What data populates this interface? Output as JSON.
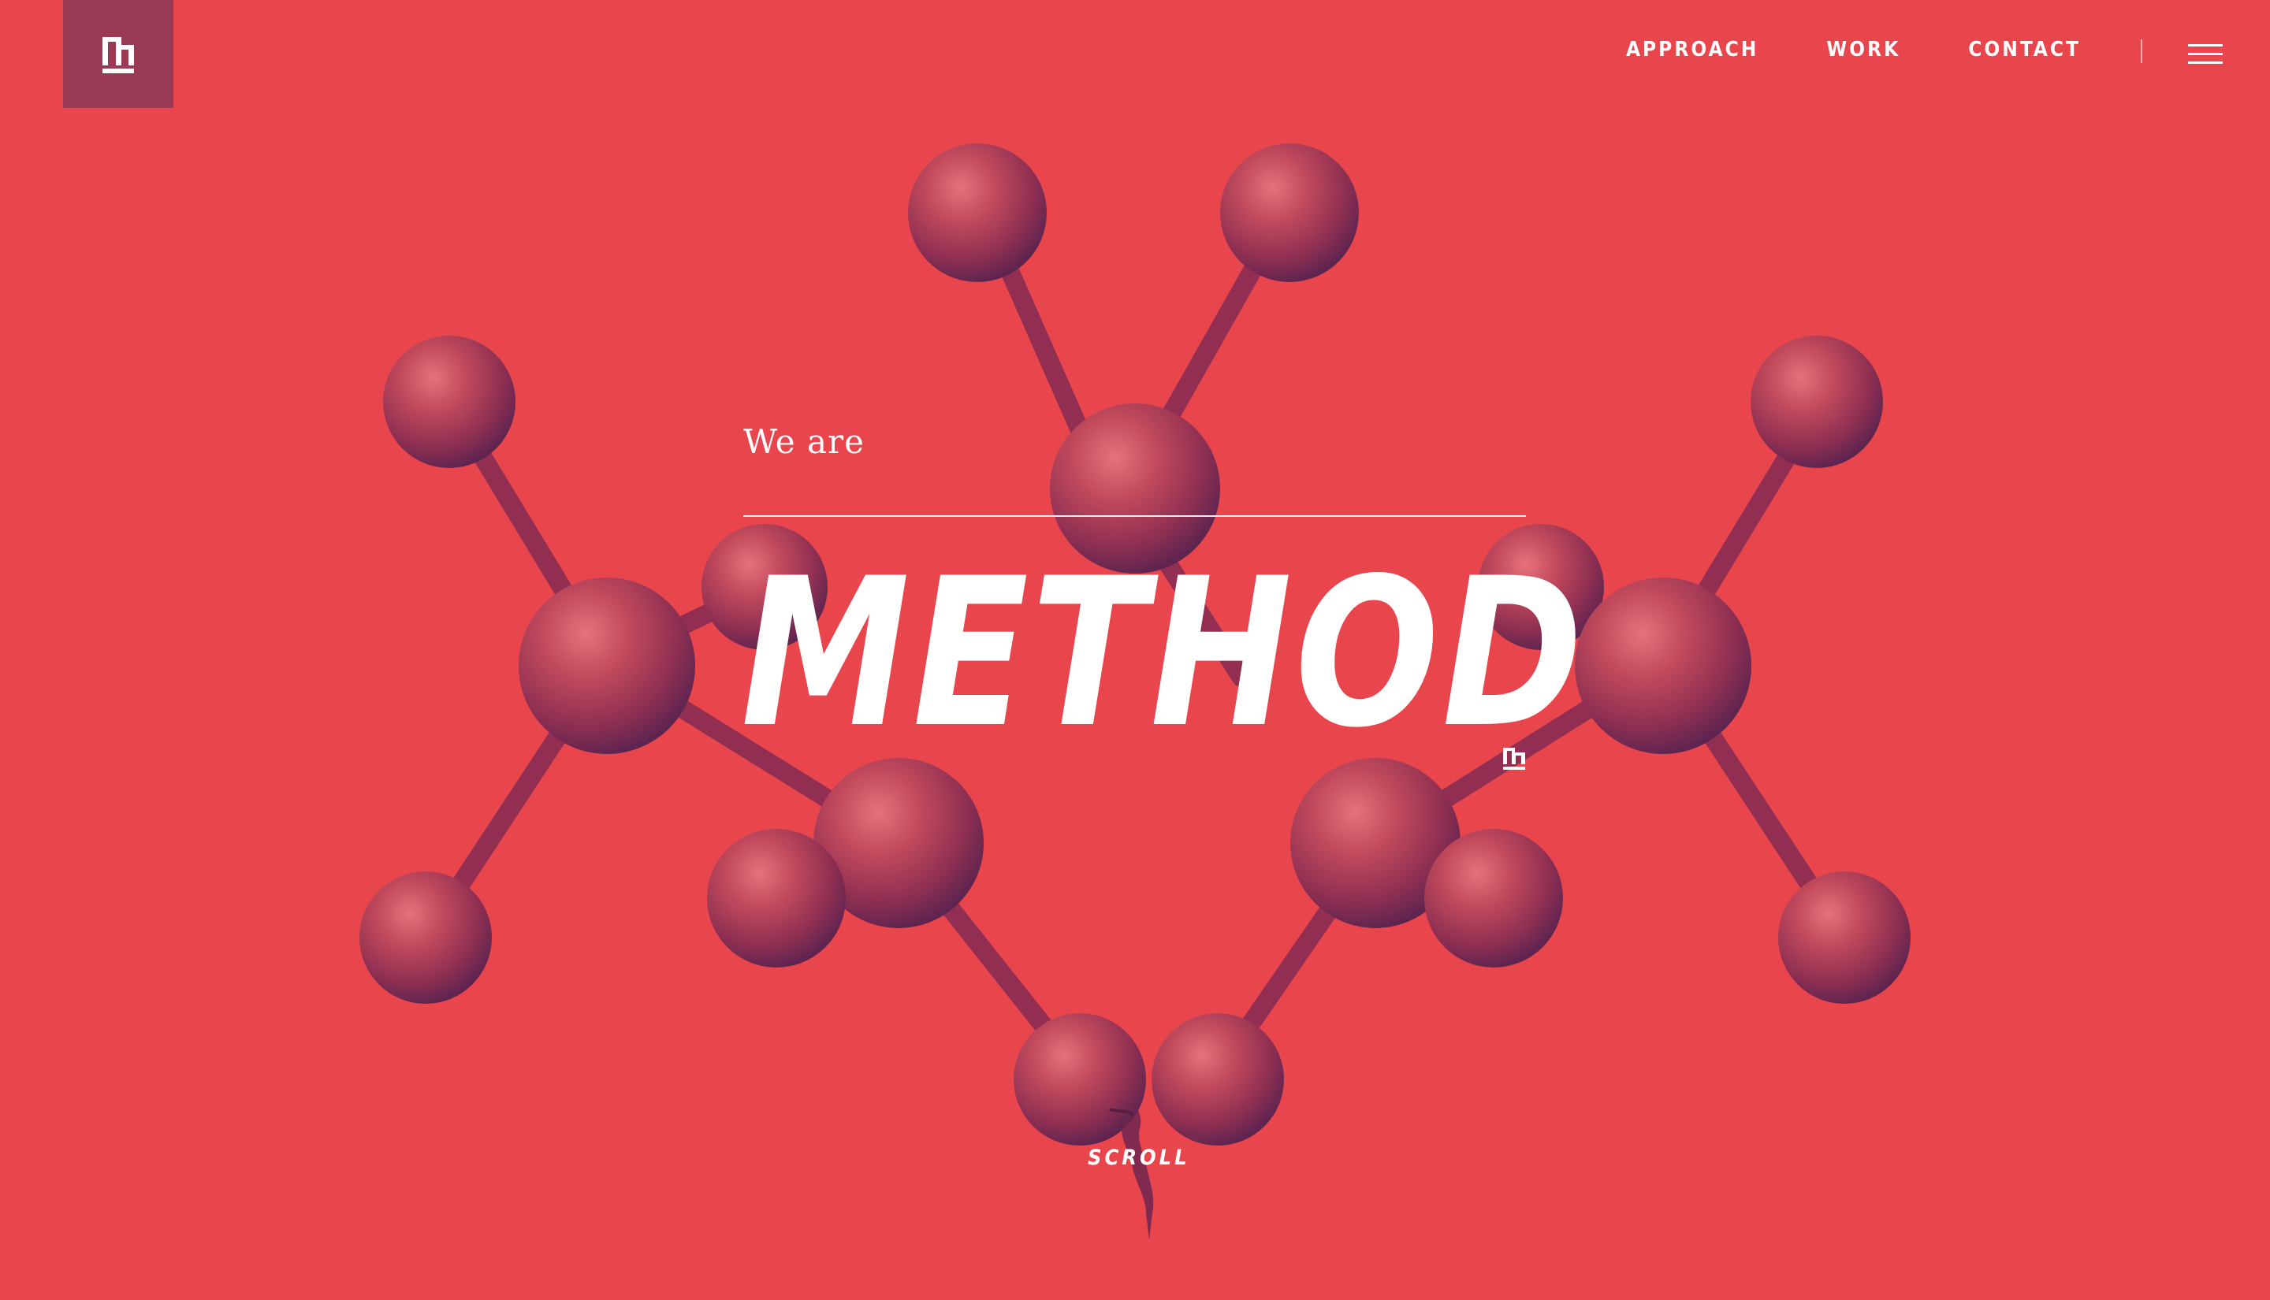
{
  "brand": {
    "logo_icon": "method-m-logo-icon",
    "background_color": "#E8464C",
    "logo_block_color": "#9B3A55",
    "molecule_color": "#8E2F52"
  },
  "nav": {
    "items": [
      {
        "label": "APPROACH"
      },
      {
        "label": "WORK"
      },
      {
        "label": "CONTACT"
      }
    ],
    "menu_icon": "hamburger-menu-icon"
  },
  "hero": {
    "intro": "We are",
    "title": "METHOD",
    "mark_icon": "method-m-logo-icon",
    "background_icon": "molecule-model-icon"
  },
  "scroll": {
    "label": "SCROLL",
    "icon": "pointing-hand-icon"
  }
}
